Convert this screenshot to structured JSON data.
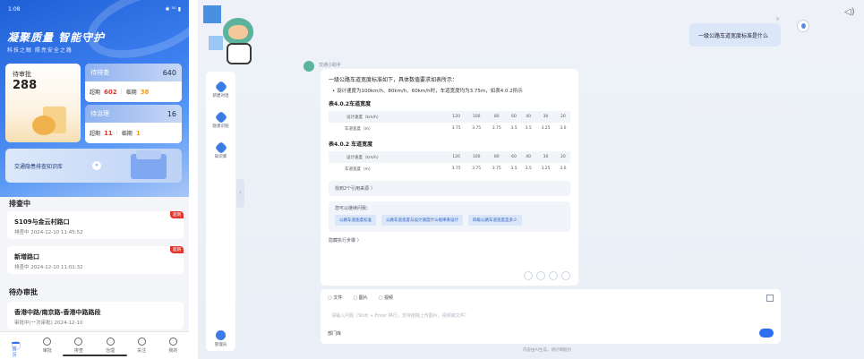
{
  "phone": {
    "status_time": "1:08",
    "status_icons": "✱ ⁵ᴳ ▮",
    "slogan": "凝聚质量 智能守护",
    "subtitle": "科技之眼 照亮安全之路",
    "pending_review": {
      "label": "待审批",
      "count": "288"
    },
    "investigation": {
      "label": "待排查",
      "count": "640",
      "overdue_label": "超期",
      "overdue_count": "602",
      "due_label": "临期",
      "due_count": "38"
    },
    "treatment": {
      "label": "待治理",
      "count": "16",
      "overdue_label": "超期",
      "overdue_count": "11",
      "due_label": "临期",
      "due_count": "1"
    },
    "knowledge": {
      "label": "交通隐患排查知识库",
      "arrow": "»"
    },
    "sections": {
      "checking": "排查中",
      "approval": "待办审批"
    },
    "items": [
      {
        "name": "S109与金云村路口",
        "meta": "排查中  2024-12-10 11:45:52",
        "tag": "超期"
      },
      {
        "name": "新增路口",
        "meta": "排查中  2024-12-10 11:01:32",
        "tag": "超期"
      },
      {
        "name": "香港中路/南京路-香港中路路段",
        "meta": "审批中(一次审批)  2024-12-10"
      }
    ],
    "tabs": [
      {
        "label": "首页",
        "icon": "home-icon"
      },
      {
        "label": "审批",
        "icon": "approval-icon"
      },
      {
        "label": "排查",
        "icon": "check-icon"
      },
      {
        "label": "治理",
        "icon": "govern-icon"
      },
      {
        "label": "关注",
        "icon": "watch-icon"
      },
      {
        "label": "我的",
        "icon": "user-icon"
      }
    ]
  },
  "desktop": {
    "sidebar": [
      {
        "label": "新建对话",
        "icon": "new-chat-icon"
      },
      {
        "label": "隐患识别",
        "icon": "hazard-icon"
      },
      {
        "label": "知识库",
        "icon": "knowledge-icon"
      }
    ],
    "sidebar_user": "管理员",
    "collapse_glyph": "›",
    "speaker_glyph": "◁)",
    "user_question": "一级公路车道宽度标准是什么",
    "user_close": "×",
    "assistant_name": "交通小助手",
    "answer_intro": "一级公路车道宽度标准如下，具体数值要求如表所示：",
    "answer_bullet": "• 设计速度为100km/h、80km/h、60km/h时，车道宽度均为3.75m，如表4.0.2所示",
    "tables": [
      {
        "caption": "表4.0.2车道宽度",
        "header": [
          "设计速度（km/h）",
          "120",
          "100",
          "80",
          "60",
          "40",
          "30",
          "20"
        ],
        "row": [
          "车道宽度（m）",
          "3.75",
          "3.75",
          "3.75",
          "3.5",
          "3.5",
          "3.25",
          "3.0"
        ]
      },
      {
        "caption": "表4.0.2 车道宽度",
        "header": [
          "设计速度（km/h）",
          "120",
          "100",
          "80",
          "60",
          "40",
          "30",
          "20"
        ],
        "row": [
          "车道宽度（m）",
          "3.75",
          "3.75",
          "3.75",
          "3.5",
          "3.5",
          "3.25",
          "3.0"
        ]
      }
    ],
    "reference": "找到2个引用来源 〉",
    "suggest_title": "您可以继续问我：",
    "suggestions": [
      "公路车道宽度标准",
      "公路车道宽度与设计速度什么规律来设计",
      "四级公路车道宽度是多少"
    ],
    "think_toggle": "隐藏执行步骤 〉",
    "input_tools": [
      "文件",
      "图片",
      "视频"
    ],
    "input_placeholder": "请输入问题（Shift + Enter 换行，支持拖拽上传图片、视频或文件）",
    "dept_toggle": "部门库",
    "disclaimer": "内容由AI生成，请仔细甄别"
  }
}
